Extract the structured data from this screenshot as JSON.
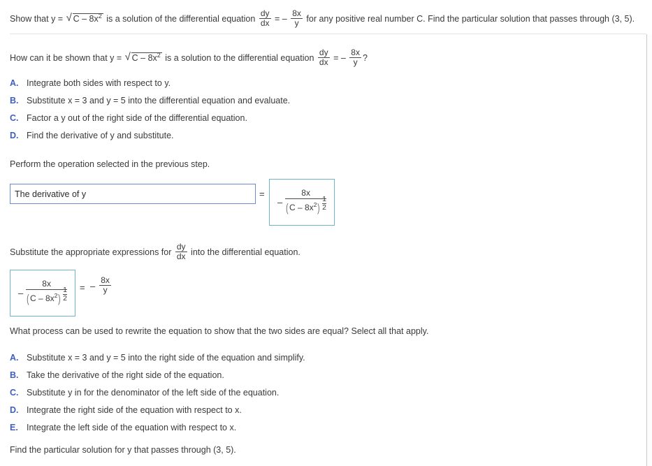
{
  "prompt": {
    "part1": "Show that y =",
    "radicand": "C – 8x",
    "radicand_exp": "2",
    "part2": "is a solution of the differential equation",
    "dydx_num": "dy",
    "dydx_den": "dx",
    "equals": "=",
    "minus": "–",
    "rhs_num": "8x",
    "rhs_den": "y",
    "part3": "for any positive real number C. Find the particular solution that passes through (3, 5)."
  },
  "question1": {
    "part1": "How can it be shown that y =",
    "radicand": "C – 8x",
    "radicand_exp": "2",
    "part2": "is a solution to the differential equation",
    "dydx_num": "dy",
    "dydx_den": "dx",
    "equals": "=",
    "minus": "–",
    "rhs_num": "8x",
    "rhs_den": "y",
    "part3": "?",
    "options": [
      {
        "letter": "A.",
        "text": "Integrate both sides with respect to y."
      },
      {
        "letter": "B.",
        "text": "Substitute x = 3 and y = 5 into the differential equation and evaluate."
      },
      {
        "letter": "C.",
        "text": "Factor a y out of the right side of the differential equation."
      },
      {
        "letter": "D.",
        "text": "Find the derivative of y and substitute."
      }
    ]
  },
  "step_perform": {
    "instruction": "Perform the operation selected in the previous step.",
    "input_value": "The derivative of y",
    "input_placeholder": "",
    "equals": "=",
    "boxed_expression": {
      "minus": "–",
      "numerator": "8x",
      "denominator_base": "C – 8x",
      "denominator_base_exp": "2",
      "denominator_exp_num": "1",
      "denominator_exp_den": "2"
    }
  },
  "step_substitute": {
    "instruction_part1": "Substitute the appropriate expressions for",
    "dydx_num": "dy",
    "dydx_den": "dx",
    "instruction_part2": "into the differential equation.",
    "left_boxed": {
      "minus": "–",
      "numerator": "8x",
      "denominator_base": "C – 8x",
      "denominator_base_exp": "2",
      "denominator_exp_num": "1",
      "denominator_exp_den": "2"
    },
    "equals": "=",
    "right_side": {
      "minus": "–",
      "numerator": "8x",
      "denominator": "y"
    }
  },
  "question2": {
    "text": "What process can be used to rewrite the equation to show that the two sides are equal? Select all that apply.",
    "options": [
      {
        "letter": "A.",
        "text": "Substitute x = 3 and y = 5 into the right side of the equation and simplify."
      },
      {
        "letter": "B.",
        "text": "Take the derivative of the right side of the equation."
      },
      {
        "letter": "C.",
        "text": "Substitute y in for the denominator of the left side of the equation."
      },
      {
        "letter": "D.",
        "text": "Integrate the right side of the equation with respect to x."
      },
      {
        "letter": "E.",
        "text": "Integrate the left side of the equation with respect to x."
      }
    ]
  },
  "final_step": {
    "text": "Find the particular solution for y that passes through (3, 5)."
  },
  "colors": {
    "option_letter": "#3f5ec0",
    "input_border": "#6a8bd0",
    "math_box_border": "#6fb3c7",
    "text": "#3a3a3a",
    "divider": "#e3e3e3"
  }
}
